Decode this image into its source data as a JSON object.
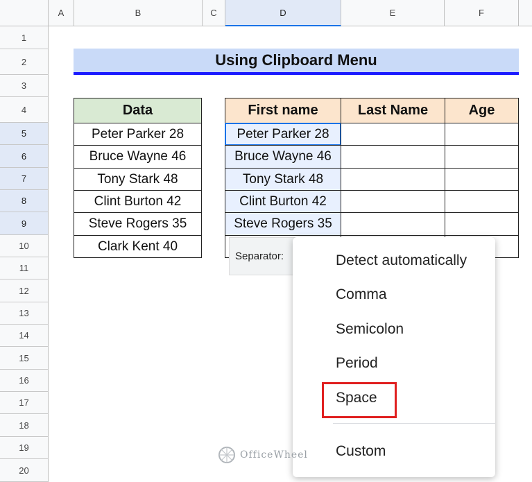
{
  "columns": [
    "A",
    "B",
    "C",
    "D",
    "E",
    "F"
  ],
  "rows": [
    "1",
    "2",
    "3",
    "4",
    "5",
    "6",
    "7",
    "8",
    "9",
    "10",
    "11",
    "12",
    "13",
    "14",
    "15",
    "16",
    "17",
    "18",
    "19",
    "20"
  ],
  "title": "Using Clipboard Menu",
  "data_table": {
    "header": "Data",
    "rows": [
      "Peter Parker 28",
      "Bruce Wayne 46",
      "Tony Stark 48",
      "Clint Burton 42",
      "Steve Rogers 35",
      "Clark Kent 40"
    ]
  },
  "result_table": {
    "headers": [
      "First name",
      "Last Name",
      "Age"
    ],
    "rows": [
      "Peter Parker 28",
      "Bruce Wayne 46",
      "Tony Stark 48",
      "Clint Burton 42",
      "Steve Rogers 35"
    ]
  },
  "paste_toolbar": {
    "separator_label": "Separator:"
  },
  "separator_menu": {
    "items": [
      "Detect automatically",
      "Comma",
      "Semicolon",
      "Period",
      "Space",
      "Custom"
    ],
    "highlighted": "Space"
  },
  "watermark": "OfficeWheel",
  "colors": {
    "title_fill": "#c9daf8",
    "title_border": "#1a1aff",
    "data_header": "#d9ead3",
    "result_header": "#fce5cd",
    "highlight": "#e02020"
  }
}
